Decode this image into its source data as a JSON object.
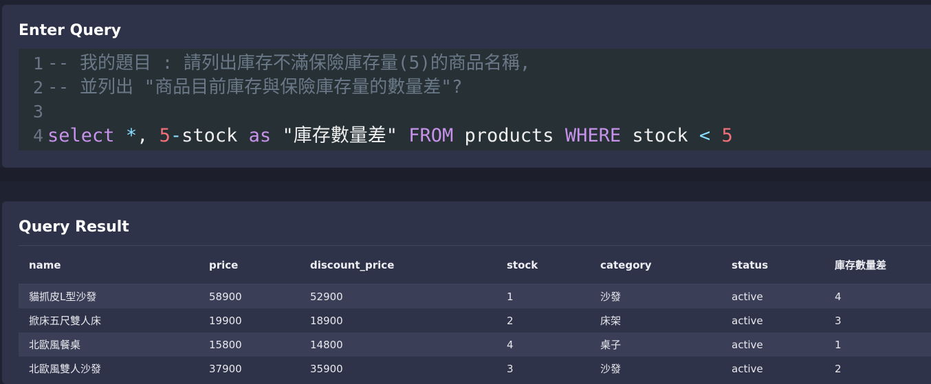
{
  "query_panel": {
    "title": "Enter Query",
    "lines": [
      {
        "number": "1",
        "tokens": [
          {
            "type": "comment",
            "text": "-- 我的題目 : 請列出庫存不滿保險庫存量(5)的商品名稱,"
          }
        ]
      },
      {
        "number": "2",
        "tokens": [
          {
            "type": "comment",
            "text": "-- 並列出 \"商品目前庫存與保險庫存量的數量差\"?"
          }
        ]
      },
      {
        "number": "3",
        "tokens": []
      },
      {
        "number": "4",
        "tokens": [
          {
            "type": "keyword",
            "text": "select"
          },
          {
            "type": "plain",
            "text": " "
          },
          {
            "type": "operator",
            "text": "*"
          },
          {
            "type": "plain",
            "text": ", "
          },
          {
            "type": "number",
            "text": "5"
          },
          {
            "type": "operator",
            "text": "-"
          },
          {
            "type": "plain",
            "text": "stock "
          },
          {
            "type": "keyword",
            "text": "as"
          },
          {
            "type": "plain",
            "text": " "
          },
          {
            "type": "string",
            "text": "\"庫存數量差\""
          },
          {
            "type": "plain",
            "text": " "
          },
          {
            "type": "keyword",
            "text": "FROM"
          },
          {
            "type": "plain",
            "text": " products "
          },
          {
            "type": "keyword",
            "text": "WHERE"
          },
          {
            "type": "plain",
            "text": " stock "
          },
          {
            "type": "operator",
            "text": "<"
          },
          {
            "type": "plain",
            "text": " "
          },
          {
            "type": "number",
            "text": "5"
          }
        ]
      }
    ]
  },
  "result_panel": {
    "title": "Query Result",
    "columns": [
      "name",
      "price",
      "discount_price",
      "stock",
      "category",
      "status",
      "庫存數量差"
    ],
    "rows": [
      [
        "貓抓皮L型沙發",
        "58900",
        "52900",
        "1",
        "沙發",
        "active",
        "4"
      ],
      [
        "掀床五尺雙人床",
        "19900",
        "18900",
        "2",
        "床架",
        "active",
        "3"
      ],
      [
        "北歐風餐桌",
        "15800",
        "14800",
        "4",
        "桌子",
        "active",
        "1"
      ],
      [
        "北歐風雙人沙發",
        "37900",
        "35900",
        "3",
        "沙發",
        "active",
        "2"
      ]
    ]
  }
}
